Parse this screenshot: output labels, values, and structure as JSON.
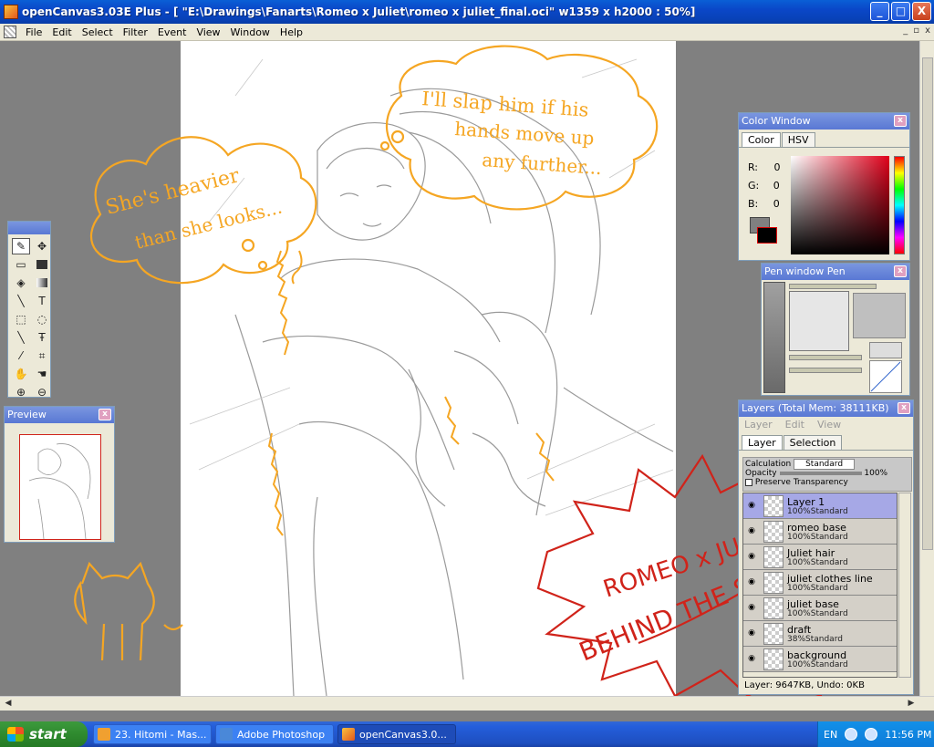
{
  "window": {
    "title": "openCanvas3.03E Plus - [ \"E:\\Drawings\\Fanarts\\Romeo x Juliet\\romeo x juliet_final.oci\" w1359 x h2000 : 50%]",
    "min_label": "_",
    "max_label": "□",
    "close_label": "X"
  },
  "menu": {
    "items": [
      "File",
      "Edit",
      "Select",
      "Filter",
      "Event",
      "View",
      "Window",
      "Help"
    ],
    "mdi_min": "_",
    "mdi_restore": "▫",
    "mdi_close": "x"
  },
  "annotations": {
    "bubble_left_line1": "She's heavier",
    "bubble_left_line2": "than she looks...",
    "bubble_right_line1": "I'll slap him if his",
    "bubble_right_line2": "hands move up",
    "bubble_right_line3": "any further...",
    "stamp_line1": "ROMEO x JULIET",
    "stamp_line2": "BEHIND THE SCENE"
  },
  "preview": {
    "title": "Preview",
    "close": "x"
  },
  "color_window": {
    "title": "Color Window",
    "close": "x",
    "tabs": [
      "Color",
      "HSV"
    ],
    "r_label": "R:",
    "r_value": "0",
    "g_label": "G:",
    "g_value": "0",
    "b_label": "B:",
    "b_value": "0"
  },
  "pen_window": {
    "title": "Pen window  Pen",
    "close": "x"
  },
  "layers": {
    "title": "Layers (Total Mem: 38111KB)",
    "close": "x",
    "menu": [
      "Layer",
      "Edit",
      "View"
    ],
    "tabs": [
      "Layer",
      "Selection"
    ],
    "calc_label": "Calculation",
    "calc_value": "Standard",
    "opacity_label": "Opacity",
    "opacity_value": "100%",
    "preserve_label": "Preserve Transparency",
    "items": [
      {
        "name": "Layer 1",
        "info": "100%Standard"
      },
      {
        "name": "romeo base",
        "info": "100%Standard"
      },
      {
        "name": "Juliet hair",
        "info": "100%Standard"
      },
      {
        "name": "juliet clothes line",
        "info": "100%Standard"
      },
      {
        "name": "juliet base",
        "info": "100%Standard"
      },
      {
        "name": "draft",
        "info": "38%Standard"
      },
      {
        "name": "background",
        "info": "100%Standard"
      }
    ],
    "status": "Layer: 9647KB, Undo: 0KB"
  },
  "taskbar": {
    "start": "start",
    "tasks": [
      "23. Hitomi - Mas...",
      "Adobe Photoshop",
      "openCanvas3.0..."
    ],
    "lang": "EN",
    "clock": "11:56 PM"
  },
  "colors": {
    "orange_ink": "#f5a623",
    "red_ink": "#d0231a",
    "xp_blue": "#0a47c8"
  }
}
